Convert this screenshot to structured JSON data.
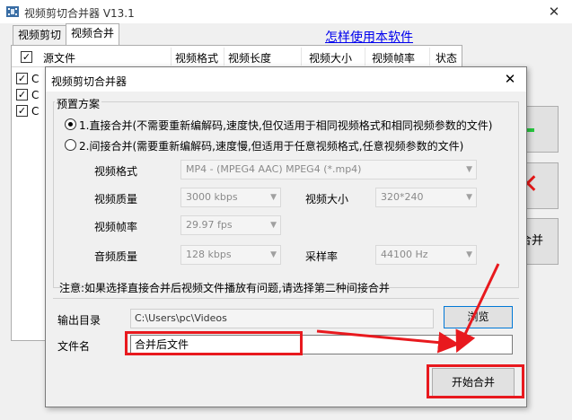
{
  "window": {
    "title": "视频剪切合并器 V13.1",
    "close_glyph": "✕"
  },
  "tabs": [
    {
      "label": "视频剪切",
      "active": false
    },
    {
      "label": "视频合并",
      "active": true
    }
  ],
  "help_link": "怎样使用本软件",
  "list": {
    "columns": [
      "源文件",
      "视频格式",
      "视频长度",
      "视频大小",
      "视频帧率",
      "状态"
    ],
    "rows": [
      {
        "checked": true,
        "text": "C"
      },
      {
        "checked": true,
        "text": "C"
      },
      {
        "checked": true,
        "text": "C"
      }
    ]
  },
  "side_buttons": {
    "merge_partial": "合并"
  },
  "dialog": {
    "title": "视频剪切合并器",
    "close_glyph": "✕",
    "preset_group": "预置方案",
    "option1": "1.直接合并(不需要重新编解码,速度快,但仅适用于相同视频格式和相同视频参数的文件)",
    "option2": "2.间接合并(需要重新编解码,速度慢,但适用于任意视频格式,任意视频参数的文件)",
    "selected_option": 1,
    "fields": {
      "video_format_label": "视频格式",
      "video_format_value": "MP4 - (MPEG4 AAC) MPEG4 (*.mp4)",
      "video_quality_label": "视频质量",
      "video_quality_value": "3000 kbps",
      "video_size_label": "视频大小",
      "video_size_value": "320*240",
      "frame_rate_label": "视频帧率",
      "frame_rate_value": "29.97 fps",
      "audio_quality_label": "音频质量",
      "audio_quality_value": "128 kbps",
      "sample_rate_label": "采样率",
      "sample_rate_value": "44100 Hz"
    },
    "note": "注意:如果选择直接合并后视频文件播放有问题,请选择第二种间接合并",
    "output_dir_label": "输出目录",
    "output_dir_value": "C:\\Users\\pc\\Videos",
    "browse_label": "浏览",
    "filename_label": "文件名",
    "filename_value": "合并后文件",
    "start_label": "开始合并"
  },
  "colors": {
    "annotation": "#e8191e",
    "link": "#0000ee",
    "focus": "#0078d7"
  }
}
